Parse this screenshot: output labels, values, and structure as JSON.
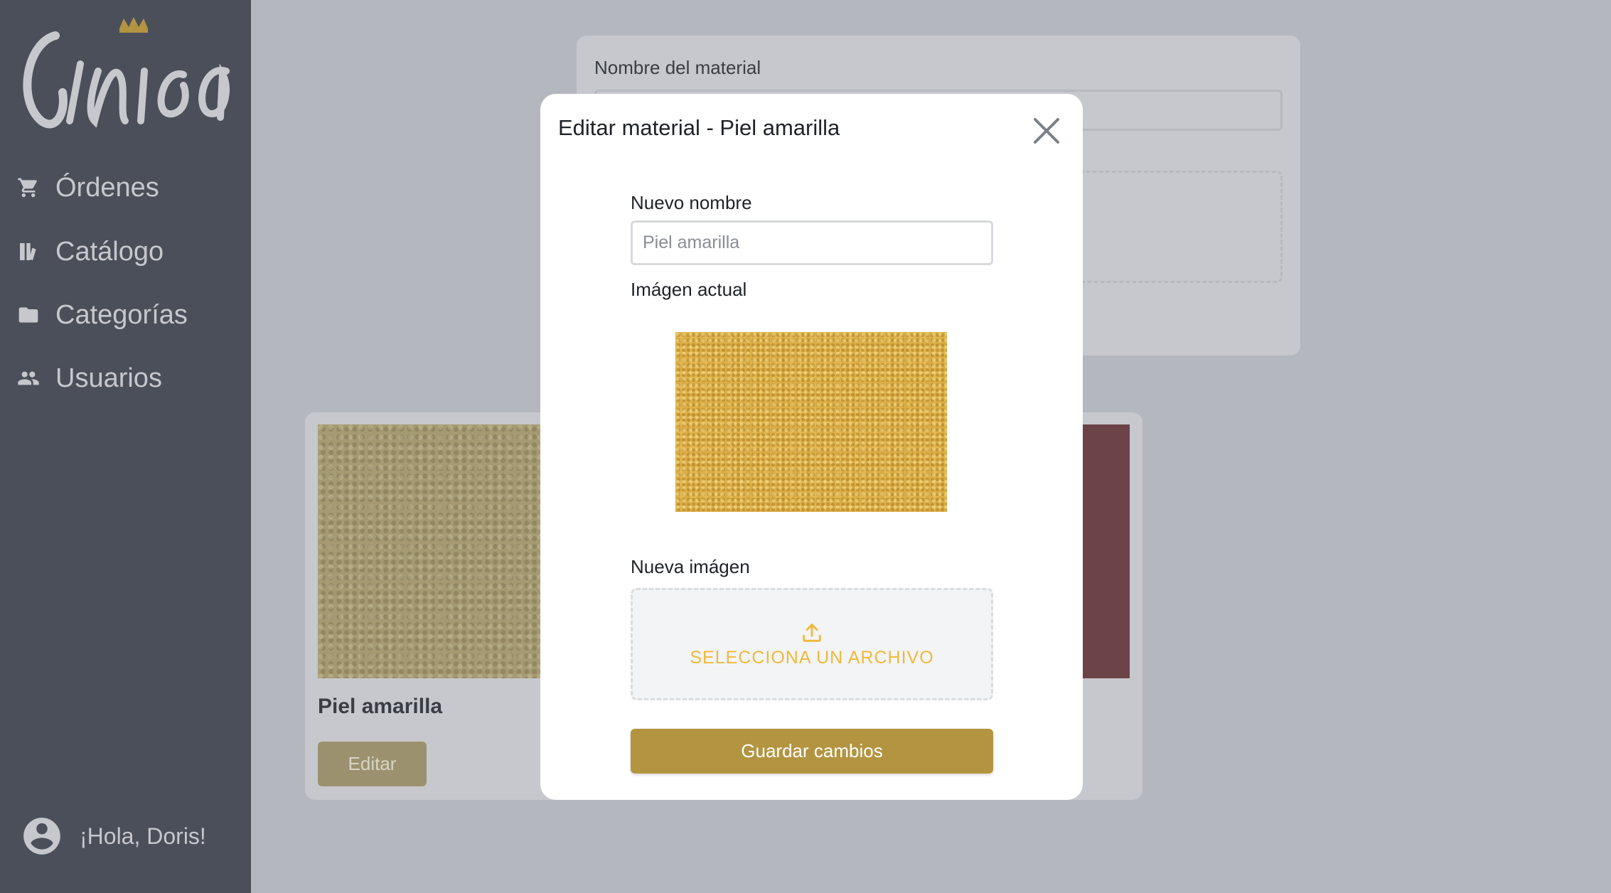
{
  "brand": {
    "logo_text": "Cinica",
    "accent": "#b39440"
  },
  "sidebar": {
    "items": [
      {
        "label": "Órdenes",
        "icon": "cart-icon"
      },
      {
        "label": "Catálogo",
        "icon": "catalog-icon"
      },
      {
        "label": "Categorías",
        "icon": "folder-icon"
      },
      {
        "label": "Usuarios",
        "icon": "users-icon"
      }
    ],
    "greeting": "¡Hola, Doris!"
  },
  "main": {
    "form": {
      "name_label": "Nombre del material"
    },
    "materials": [
      {
        "title": "Piel amarilla",
        "edit_label": "Editar",
        "color": "#a59a72"
      },
      {
        "title": "",
        "edit_label": "",
        "color": "#6c4347"
      }
    ]
  },
  "modal": {
    "title": "Editar material - Piel amarilla",
    "name_label": "Nuevo nombre",
    "name_placeholder": "Piel amarilla",
    "current_image_label": "Imágen actual",
    "new_image_label": "Nueva imágen",
    "upload_text": "SELECCIONA UN ARCHIVO",
    "save_label": "Guardar cambios"
  }
}
